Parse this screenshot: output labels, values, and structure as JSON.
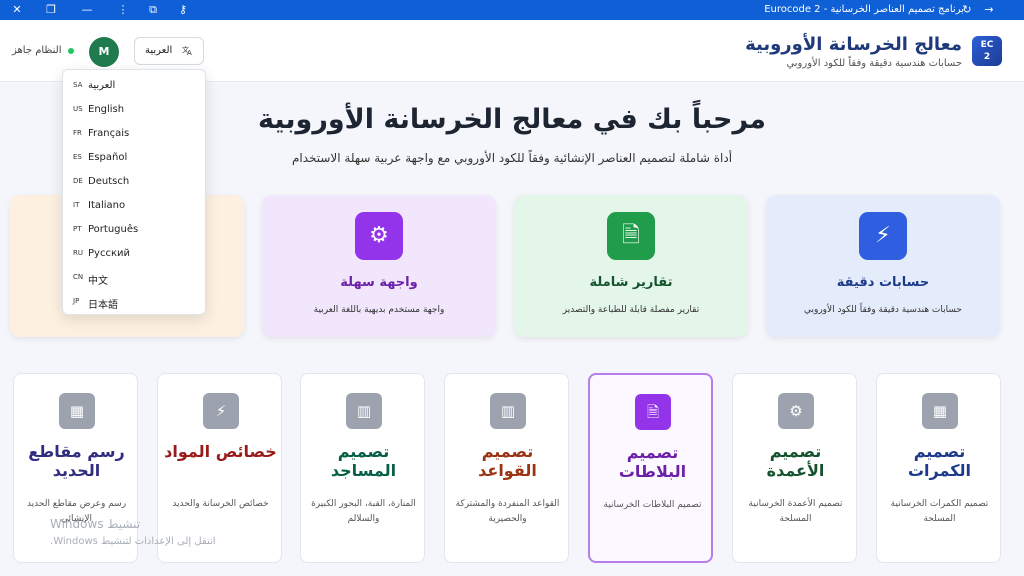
{
  "window": {
    "title": "برنامج تصميم العناصر الخرسانية - Eurocode 2",
    "close_glyph": "✕",
    "restore_glyph": "❐",
    "minimize_glyph": "—",
    "more_glyph": "⋮",
    "extension_glyph": "⧉",
    "key_glyph": "⚷",
    "refresh_glyph": "↻",
    "forward_glyph": "→"
  },
  "header": {
    "logo_line1": "EC",
    "logo_line2": "2",
    "title": "معالج الخرسانة الأوروبية",
    "subtitle": "حسابات هندسية دقيقة وفقاً للكود الأوروبي",
    "status": "النظام جاهز",
    "status_color": "#22c55e",
    "avatar": "M",
    "language_button": "العربية",
    "language_icon": "translate-icon"
  },
  "language_menu": [
    {
      "code": "SA",
      "name": "العربية"
    },
    {
      "code": "US",
      "name": "English"
    },
    {
      "code": "FR",
      "name": "Français"
    },
    {
      "code": "ES",
      "name": "Español"
    },
    {
      "code": "DE",
      "name": "Deutsch"
    },
    {
      "code": "IT",
      "name": "Italiano"
    },
    {
      "code": "PT",
      "name": "Português"
    },
    {
      "code": "RU",
      "name": "Русский"
    },
    {
      "code": "CN",
      "name": "中文"
    },
    {
      "code": "JP",
      "name": "日本語"
    }
  ],
  "hero": {
    "title": "مرحباً بك في معالج الخرسانة الأوروبية",
    "subtitle": "أداة شاملة لتصميم العناصر الإنشائية وفقاً للكود الأوروبي مع واجهة عربية سهلة الاستخدام"
  },
  "features": [
    {
      "title": "حسابات دقيقة",
      "desc": "حسابات هندسية دقيقة وفقاً للكود الأوروبي",
      "icon": "bolt-icon",
      "glyph": "⚡",
      "color": "#2f5fe0",
      "bg": "#e4ecfc",
      "title_color": "#1e3a8a"
    },
    {
      "title": "تقارير شاملة",
      "desc": "تقارير مفصلة قابلة للطباعة والتصدير",
      "icon": "document-icon",
      "glyph": "🗎",
      "color": "#1f9d4b",
      "bg": "#e3f6e9",
      "title_color": "#14532d"
    },
    {
      "title": "واجهة سهلة",
      "desc": "واجهة مستخدم بديهية باللغة العربية",
      "icon": "gear-icon",
      "glyph": "⚙",
      "color": "#9333ea",
      "bg": "#f1e6fb",
      "title_color": "#6b21a8"
    },
    {
      "title": "",
      "desc": "",
      "icon": "feature-icon",
      "glyph": "",
      "color": "#f59e0b",
      "bg": "#fdf0e0",
      "title_color": "#92400e"
    }
  ],
  "modules": [
    {
      "title": "تصميم الكمرات",
      "desc": "تصميم الكمرات الخرسانية المسلحة",
      "icon": "calculator-icon",
      "glyph": "▦",
      "color": "#9ca3af",
      "title_color": "#1e3a8a",
      "active": false
    },
    {
      "title": "تصميم الأعمدة",
      "desc": "تصميم الأعمدة الخرسانية المسلحة",
      "icon": "gear-icon",
      "glyph": "⚙",
      "color": "#9ca3af",
      "title_color": "#14532d",
      "active": false
    },
    {
      "title": "تصميم البلاطات",
      "desc": "تصميم البلاطات الخرسانية",
      "icon": "document-icon",
      "glyph": "🗎",
      "color": "#9333ea",
      "title_color": "#6b21a8",
      "active": true
    },
    {
      "title": "تصميم القواعد",
      "desc": "القواعد المنفردة والمشتركة والحصيرية",
      "icon": "building-icon",
      "glyph": "▥",
      "color": "#9ca3af",
      "title_color": "#9a3412",
      "active": false
    },
    {
      "title": "تصميم المساجد",
      "desc": "المنارة، القبة، البحور الكبيرة والسلالم",
      "icon": "building-icon",
      "glyph": "▥",
      "color": "#9ca3af",
      "title_color": "#065f46",
      "active": false
    },
    {
      "title": "خصائص المواد",
      "desc": "خصائص الخرسانة والحديد",
      "icon": "bolt-icon",
      "glyph": "⚡",
      "color": "#9ca3af",
      "title_color": "#991b1b",
      "active": false
    },
    {
      "title": "رسم مقاطع الحديد",
      "desc": "رسم وعرض مقاطع الحديد الإنشائي",
      "icon": "calculator-icon",
      "glyph": "▦",
      "color": "#9ca3af",
      "title_color": "#312e81",
      "active": false
    }
  ],
  "watermark": {
    "line1": "تنشيط Windows",
    "line2": "انتقل إلى الإعدادات لتنشيط Windows."
  }
}
